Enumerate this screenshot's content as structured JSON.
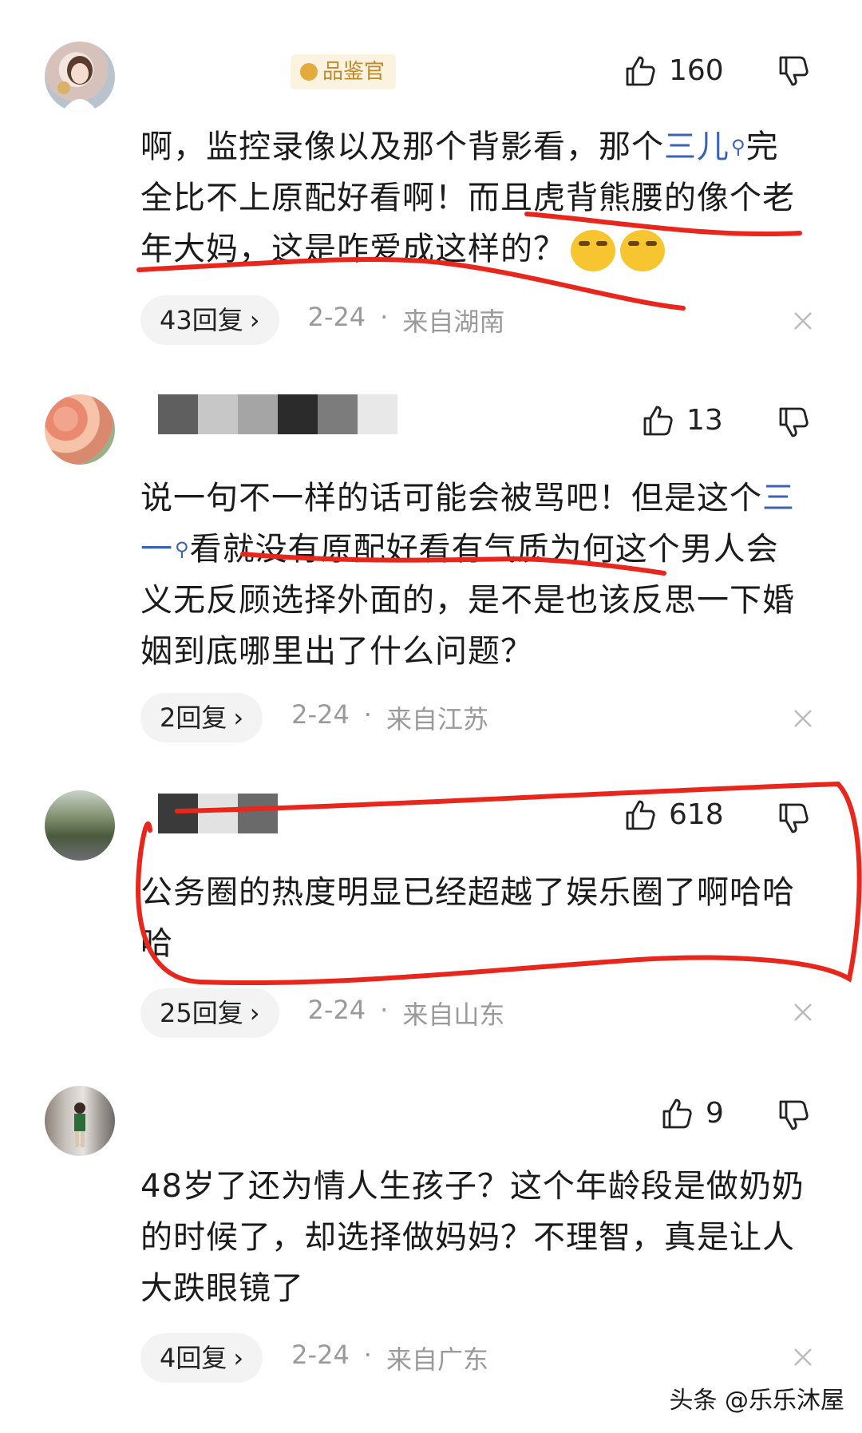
{
  "comments": [
    {
      "badge": "品鉴官",
      "likes": "160",
      "text_parts": [
        "啊，监控录像以及那个背影看，那个",
        "三儿",
        "完全比不上原配好看啊！而且虎背熊腰的像个老年大妈，这是咋爱成这样的？"
      ],
      "replies": "43回复",
      "date": "2-24",
      "location": "来自湖南"
    },
    {
      "likes": "13",
      "text_parts": [
        "说一句不一样的话可能会被骂吧！但是这个",
        "三一",
        "看就没有原配好看有气质为何这个男人会义无反顾选择外面的，是不是也该反思一下婚姻到底哪里出了什么问题？"
      ],
      "replies": "2回复",
      "date": "2-24",
      "location": "来自江苏"
    },
    {
      "likes": "618",
      "text": "公务圈的热度明显已经超越了娱乐圈了啊哈哈哈",
      "replies": "25回复",
      "date": "2-24",
      "location": "来自山东"
    },
    {
      "likes": "9",
      "text": "48岁了还为情人生孩子？这个年龄段是做奶奶的时候了，却选择做妈妈？不理智，真是让人大跌眼镜了",
      "replies": "4回复",
      "date": "2-24",
      "location": "来自广东"
    }
  ],
  "separator": "·",
  "watermark": "头条 @乐乐沐屋",
  "colors": {
    "link": "#3b63b5",
    "highlight_pen": "#e8261c",
    "badge_bg": "#fbf3df",
    "badge_text": "#c08a2a"
  },
  "icons": [
    "thumbs-up-icon",
    "thumbs-down-icon",
    "close-icon",
    "search-link-icon",
    "chevron-right-icon",
    "laugh-cry-emoji"
  ]
}
